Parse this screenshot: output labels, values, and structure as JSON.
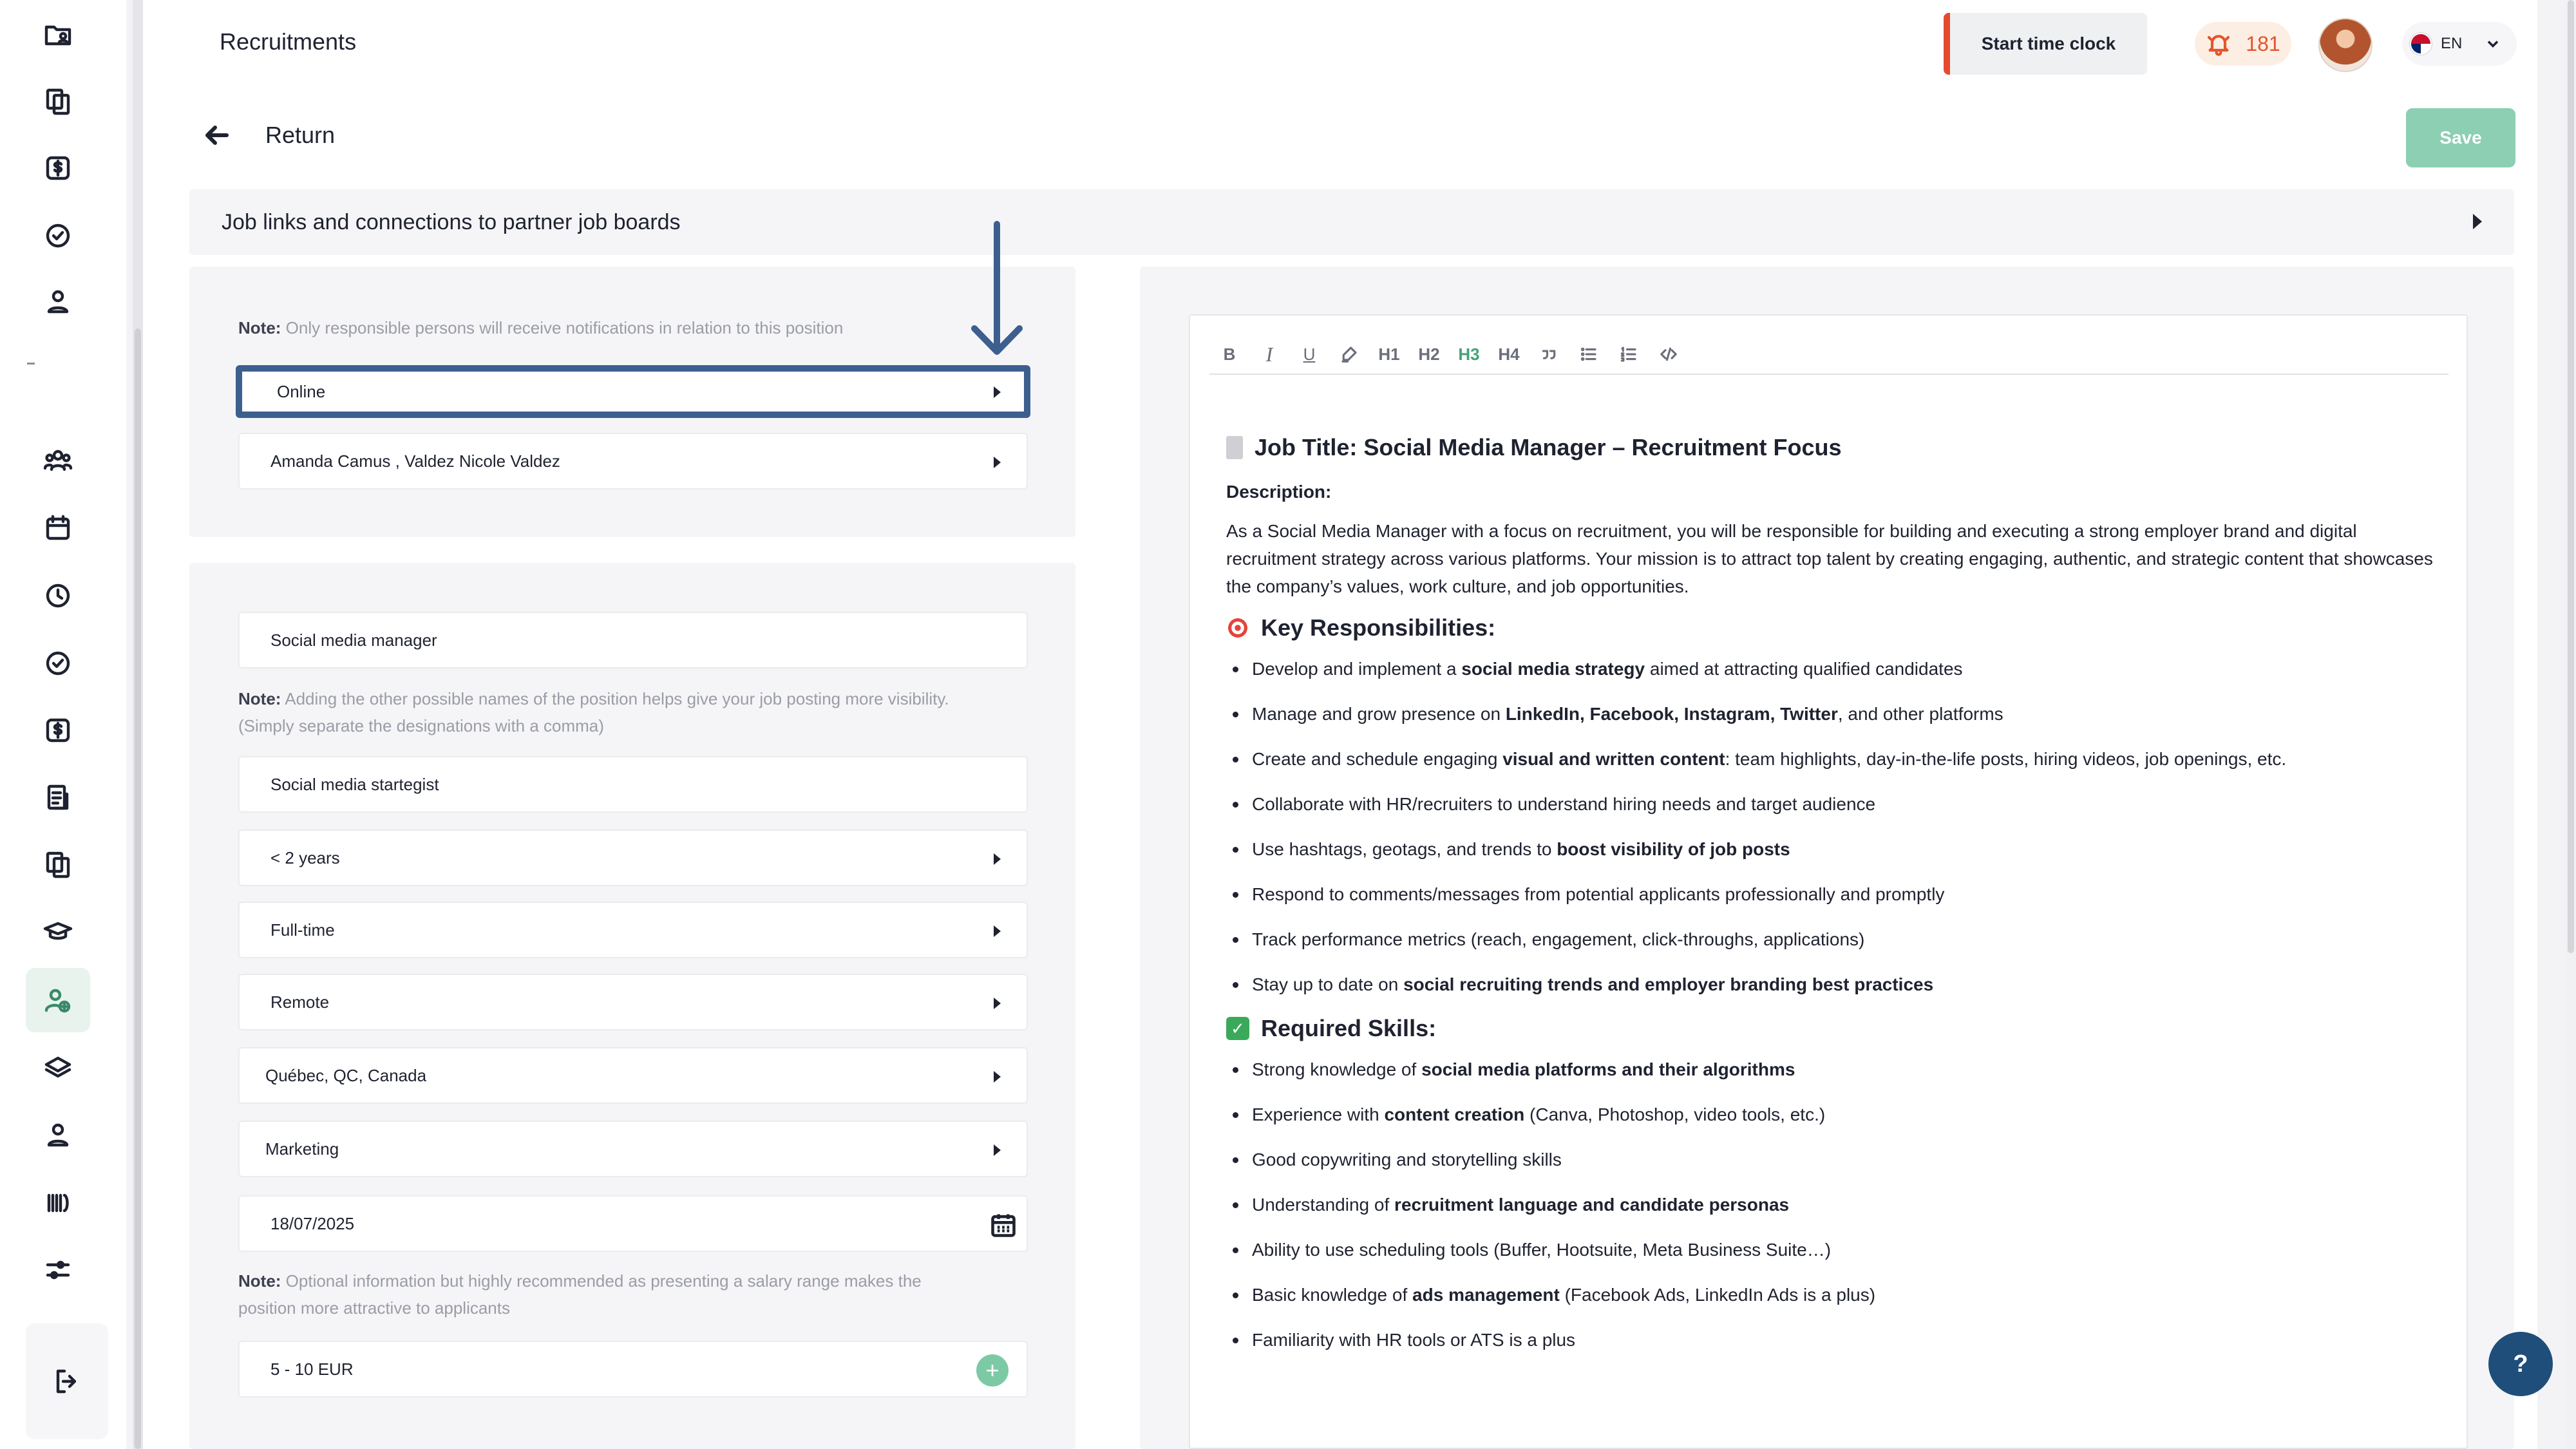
{
  "header": {
    "title": "Recruitments",
    "clock_button": "Start time clock",
    "notifications_count": "181",
    "language": "EN"
  },
  "nav": {
    "return_label": "Return",
    "save_label": "Save"
  },
  "job_links": {
    "label": "Job links and connections to partner job boards"
  },
  "responsible": {
    "note_bold": "Note:",
    "note_text": " Only responsible persons will receive notifications in relation to this position",
    "status": "Online",
    "persons": "Amanda  Camus , Valdez Nicole Valdez"
  },
  "position": {
    "title": "Social media manager",
    "alt_note_bold": "Note:",
    "alt_note_text": " Adding the other possible names of the position helps give your job posting more visibility.",
    "alt_note_text2": "(Simply separate the designations with a comma)",
    "alt_names": "Social media startegist",
    "experience": "< 2 years",
    "contract": "Full-time",
    "work_mode": "Remote",
    "location": "Québec, QC, Canada",
    "department": "Marketing",
    "date": "18/07/2025",
    "salary_note_bold": "Note:",
    "salary_note_text": " Optional information but highly recommended as presenting a salary range makes the",
    "salary_note_text2": "position more attractive to applicants",
    "salary": "5 - 10 EUR"
  },
  "editor": {
    "toolbar": [
      "B",
      "I",
      "U",
      "H1",
      "H2",
      "H3",
      "H4"
    ],
    "job_title": "Job Title: Social Media Manager – Recruitment Focus",
    "description_label": "Description:",
    "description": "As a Social Media Manager with a focus on recruitment, you will be responsible for building and executing a strong employer brand and digital recruitment strategy across various platforms. Your mission is to attract top talent by creating engaging, authentic, and strategic content that showcases the company’s values, work culture, and job opportunities.",
    "responsibilities_title": "Key Responsibilities:",
    "responsibilities": [
      {
        "pre": "Develop and implement a ",
        "bold": "social media strategy",
        "post": " aimed at attracting qualified candidates"
      },
      {
        "pre": "Manage and grow presence on ",
        "bold": "LinkedIn, Facebook, Instagram, Twitter",
        "post": ", and other platforms"
      },
      {
        "pre": "Create and schedule engaging ",
        "bold": "visual and written content",
        "post": ": team highlights, day-in-the-life posts, hiring videos, job openings, etc."
      },
      {
        "pre": "Collaborate with HR/recruiters to understand hiring needs and target audience",
        "bold": "",
        "post": ""
      },
      {
        "pre": "Use hashtags, geotags, and trends to ",
        "bold": "boost visibility of job posts",
        "post": ""
      },
      {
        "pre": "Respond to comments/messages from potential applicants professionally and promptly",
        "bold": "",
        "post": ""
      },
      {
        "pre": "Track performance metrics (reach, engagement, click-throughs, applications)",
        "bold": "",
        "post": ""
      },
      {
        "pre": "Stay up to date on ",
        "bold": "social recruiting trends and employer branding best practices",
        "post": ""
      }
    ],
    "skills_title": "Required Skills:",
    "skills": [
      {
        "pre": "Strong knowledge of ",
        "bold": "social media platforms and their algorithms",
        "post": ""
      },
      {
        "pre": "Experience with ",
        "bold": "content creation",
        "post": " (Canva, Photoshop, video tools, etc.)"
      },
      {
        "pre": "Good copywriting and storytelling skills",
        "bold": "",
        "post": ""
      },
      {
        "pre": "Understanding of ",
        "bold": "recruitment language and candidate personas",
        "post": ""
      },
      {
        "pre": "Ability to use scheduling tools (Buffer, Hootsuite, Meta Business Suite…)",
        "bold": "",
        "post": ""
      },
      {
        "pre": "Basic knowledge of ",
        "bold": "ads management",
        "post": " (Facebook Ads, LinkedIn Ads is a plus)"
      },
      {
        "pre": "Familiarity with HR tools or ATS is a plus",
        "bold": "",
        "post": ""
      }
    ]
  },
  "help": {
    "label": "?"
  }
}
